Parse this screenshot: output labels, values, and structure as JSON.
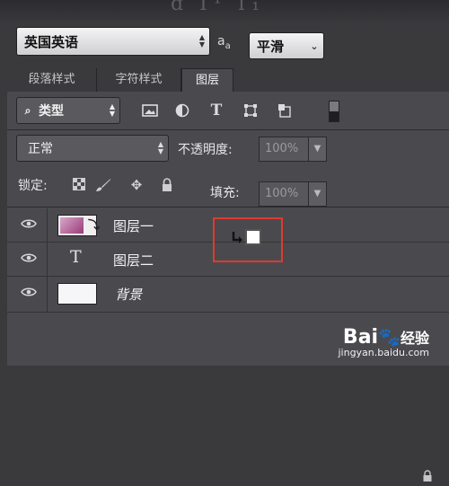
{
  "top": {
    "faint_text": "ɑ T¹ T₁"
  },
  "character": {
    "font_family_value": "英国英语",
    "aa_symbol": "a",
    "aa_sub": "a",
    "antialias_value": "平滑"
  },
  "tabs": [
    {
      "label": "段落样式",
      "active": false
    },
    {
      "label": "字符样式",
      "active": false
    },
    {
      "label": "图层",
      "active": true
    }
  ],
  "layers_panel": {
    "filter": {
      "search_glyph": "⌕",
      "value": "类型"
    },
    "filter_icons": [
      "image-icon",
      "adjustment-icon",
      "type-filter-icon",
      "shape-filter-icon",
      "smart-object-icon"
    ],
    "blend_mode": "正常",
    "opacity_label": "不透明度:",
    "opacity_value": "100%",
    "lock_label": "锁定:",
    "lock_icons": [
      "lock-pixels-grid-icon",
      "brush-icon",
      "move-icon",
      "lock-all-icon"
    ],
    "fill_label": "填充:",
    "fill_value": "100%",
    "layers": [
      {
        "name": "图层一",
        "kind": "image",
        "visible": true
      },
      {
        "name": "图层二",
        "kind": "text",
        "type_glyph": "T",
        "visible": true
      },
      {
        "name": "背景",
        "kind": "background",
        "visible": true,
        "locked": true
      }
    ]
  },
  "watermark": {
    "brand_left": "Bai",
    "brand_right": "经验",
    "domain": "jingyan.baidu.com"
  }
}
